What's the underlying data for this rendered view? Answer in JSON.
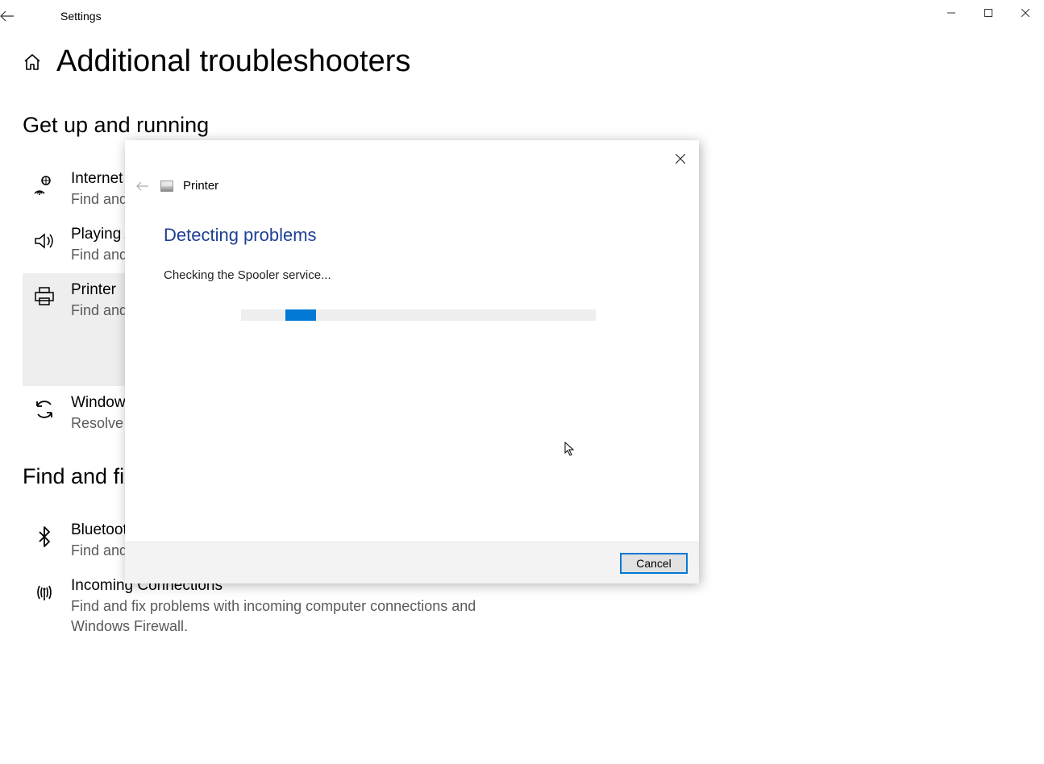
{
  "titlebar": {
    "title": "Settings"
  },
  "page": {
    "title": "Additional troubleshooters"
  },
  "sections": {
    "section1_title": "Get up and running",
    "section2_title": "Find and fix other problems"
  },
  "troubleshooters": {
    "internet": {
      "label": "Internet",
      "desc": "Find and fix problems with connecting to the Internet or to websites."
    },
    "audio": {
      "label": "Playing Audio",
      "desc": "Find and fix problems with playing sound."
    },
    "printer": {
      "label": "Printer",
      "desc": "Find and fix problems with printing."
    },
    "update": {
      "label": "Windows Update",
      "desc": "Resolve problems that prevent you from updating Windows."
    },
    "bluetooth": {
      "label": "Bluetooth",
      "desc": "Find and fix problems with Bluetooth devices"
    },
    "incoming": {
      "label": "Incoming Connections",
      "desc": "Find and fix problems with incoming computer connections and Windows Firewall."
    }
  },
  "dialog": {
    "title": "Printer",
    "heading": "Detecting problems",
    "status": "Checking the Spooler service...",
    "cancel_label": "Cancel"
  }
}
